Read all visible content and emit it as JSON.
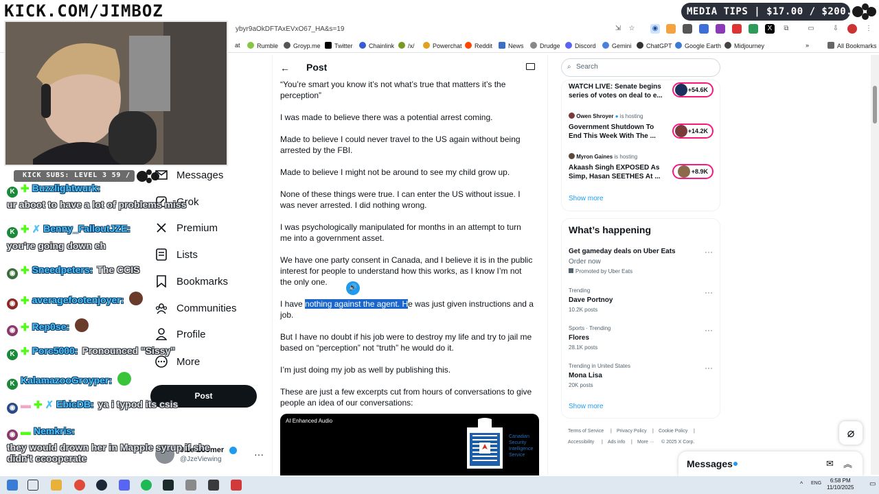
{
  "overlay": {
    "kick_url": "KICK.COM/JIMBOZ",
    "media_tips": "MEDIA TIPS | $17.00 / $200.00",
    "kick_subs": "KICK SUBS: LEVEL 3 59 / 60"
  },
  "browser": {
    "url": "ybyr9aOkDFTAxEVxO67_HA&s=19",
    "bookmarks": [
      "at",
      "Rumble",
      "Groyp.me",
      "Twitter",
      "Chainlink",
      "/x/",
      "Powerchat",
      "Reddit",
      "News",
      "Drudge",
      "Discord",
      "Gemini",
      "ChatGPT",
      "Google Earth",
      "Midjourney"
    ],
    "all_bookmarks": "All Bookmarks"
  },
  "chat": [
    {
      "name": "Buzzlightwurk:",
      "msg": "",
      "line2": "ur aboot to have a lot of problems miss"
    },
    {
      "name": "Benny_FalloutJZE:",
      "msg": "",
      "line2": "you're going down eh"
    },
    {
      "name": "Sneedpeters:",
      "msg": "The CCIS",
      "line2": ""
    },
    {
      "name": "averagefootenjoyer:",
      "msg": "",
      "line2": ""
    },
    {
      "name": "Rep0se:",
      "msg": "",
      "line2": ""
    },
    {
      "name": "Porc5000:",
      "msg": "Pronounced \"Sissy\"",
      "line2": ""
    },
    {
      "name": "KalamazooGroyper:",
      "msg": "",
      "line2": ""
    },
    {
      "name": "EbicDB:",
      "msg": "ya i typod its csis",
      "line2": ""
    },
    {
      "name": "Nemkris:",
      "msg": "",
      "line2": "they would drown her in Mapple syrup if she didn't ccooperate"
    }
  ],
  "sidebar": {
    "items": [
      {
        "label": "Messages"
      },
      {
        "label": "Grok"
      },
      {
        "label": "Premium"
      },
      {
        "label": "Lists"
      },
      {
        "label": "Bookmarks"
      },
      {
        "label": "Communities"
      },
      {
        "label": "Profile"
      },
      {
        "label": "More"
      }
    ],
    "post_button": "Post",
    "account_name": "Jize Zoomer",
    "account_handle": "@JzeViewing"
  },
  "main": {
    "header_title": "Post",
    "paragraphs": [
      "“You’re smart you know it’s not what’s true that matters it’s the perception”",
      "I was made to believe there was a potential arrest coming.",
      "Made to believe I could never travel to the US again without being arrested by the FBI.",
      "Made to believe I might not be around to see my child grow up.",
      "None of these things were true. I can enter the US without issue. I was never arrested. I did nothing wrong.",
      "I was psychologically manipulated for months in an attempt to turn me into a government asset.",
      "We have one party consent in Canada, and I believe it is in the public interest for people to understand how this works, as I know I’m not the only one.",
      "But I have no doubt if his job were to destroy my life and try to jail me based on “perception” not “truth” he would do it.",
      "I’m just doing my job as well by publishing this.",
      "These are just a few excerpts cut from hours of conversations to give people an idea of our conversations:"
    ],
    "highlight_para": {
      "before": "I have ",
      "highlighted": "nothing against the agent. H",
      "after": "e was just given instructions and a job."
    },
    "video_label": "AI Enhanced Audio",
    "video_org": "Canadian Security Intelligence Service"
  },
  "right": {
    "search_placeholder": "Search",
    "live": [
      {
        "host": "",
        "hosting": "",
        "title": "WATCH LIVE: Senate begins series of votes on deal to e...",
        "count": "+54.6K"
      },
      {
        "host": "Owen Shroyer",
        "hosting": "is hosting",
        "title": "Government Shutdown To End This Week With The ...",
        "count": "+14.2K"
      },
      {
        "host": "Myron Gaines",
        "hosting": "is hosting",
        "title": "Akaash Singh EXPOSED As Simp, Hasan SEETHES At ...",
        "count": "+8.9K"
      }
    ],
    "show_more": "Show more",
    "whats_happening": "What’s happening",
    "promo_title": "Get gameday deals on Uber Eats",
    "promo_sub": "Order now",
    "promo_by": "Promoted by Uber Eats",
    "trends": [
      {
        "context": "Trending",
        "name": "Dave Portnoy",
        "posts": "10.2K posts"
      },
      {
        "context": "Sports · Trending",
        "name": "Flores",
        "posts": "28.1K posts"
      },
      {
        "context": "Trending in United States",
        "name": "Mona Lisa",
        "posts": "20K posts"
      }
    ],
    "footer": [
      "Terms of Service",
      "Privacy Policy",
      "Cookie Policy",
      "Accessibility",
      "Ads info",
      "More ···",
      "© 2025 X Corp."
    ],
    "messages_title": "Messages"
  },
  "taskbar": {
    "lang": "ENG",
    "time": "6:58 PM",
    "date": "11/10/2025"
  }
}
